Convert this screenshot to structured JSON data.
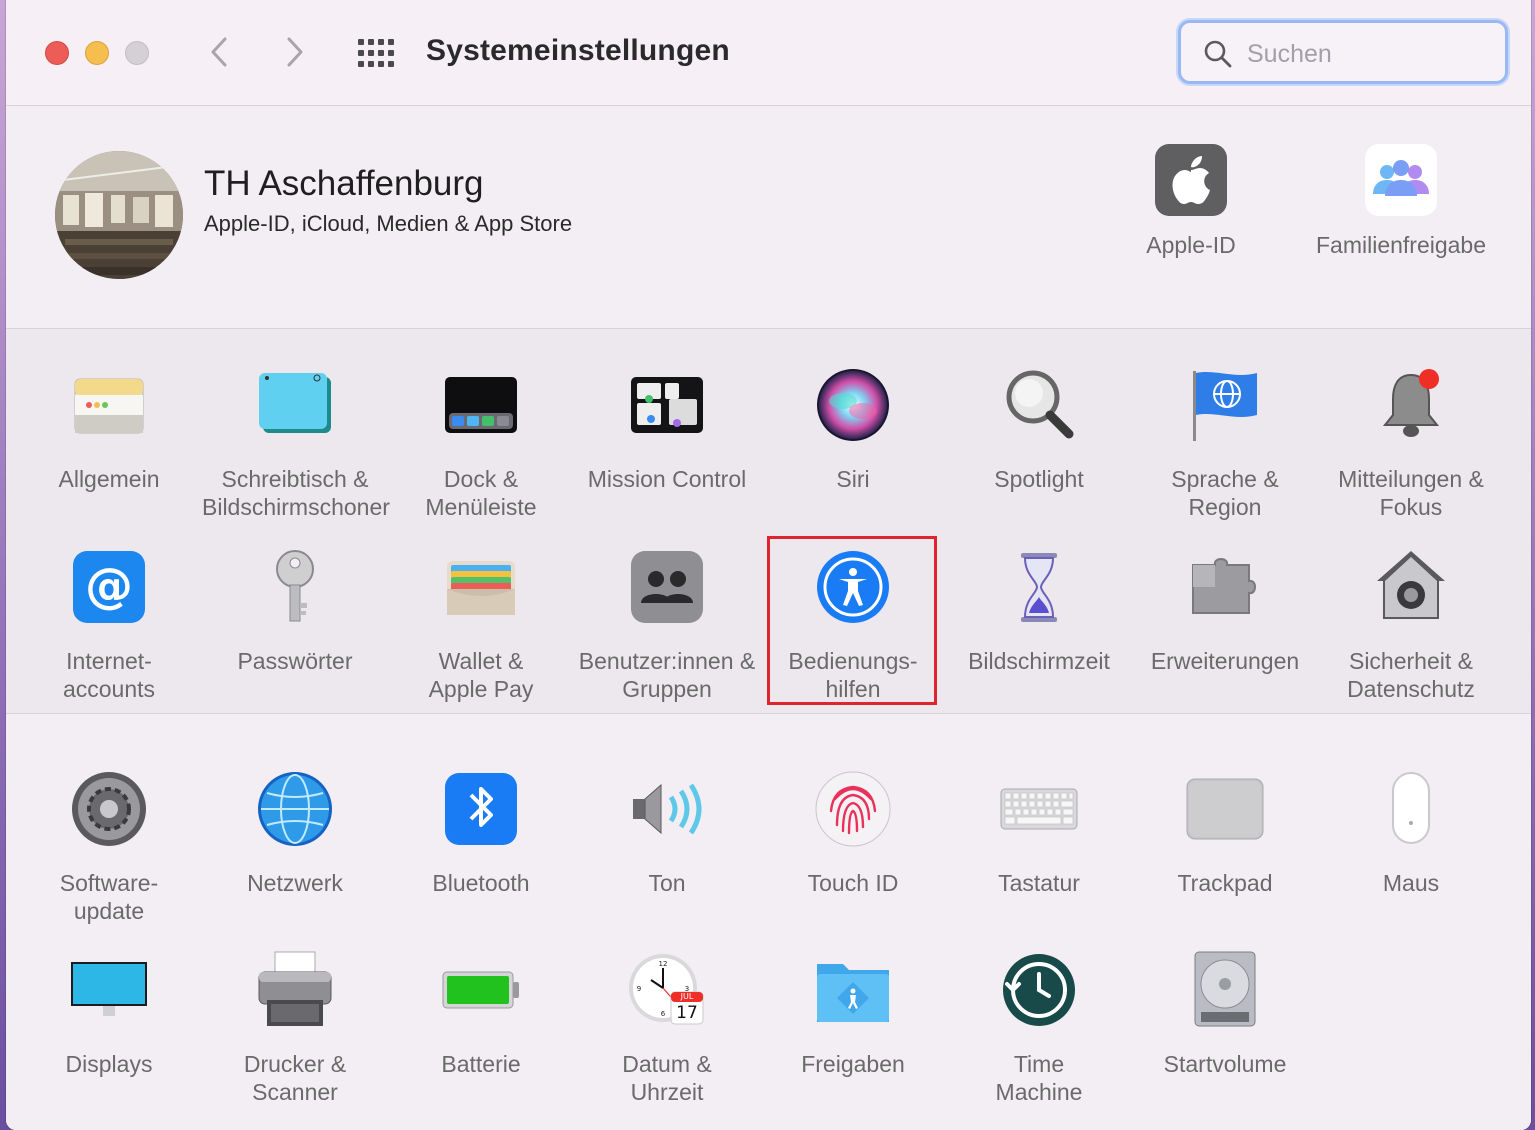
{
  "window": {
    "title": "Systemeinstellungen",
    "search_placeholder": "Suchen"
  },
  "account": {
    "name": "TH Aschaffenburg",
    "subtitle": "Apple-ID, iCloud, Medien & App Store",
    "items": [
      {
        "label": "Apple-ID",
        "icon": "apple-icon"
      },
      {
        "label": "Familienfreigabe",
        "icon": "family-sharing-icon"
      }
    ]
  },
  "prefs_row1": [
    {
      "label": "Allgemein",
      "icon": "general-icon"
    },
    {
      "label": "Schreibtisch & Bildschirmschoner",
      "icon": "desktop-screensaver-icon"
    },
    {
      "label": "Dock & Menüleiste",
      "icon": "dock-menubar-icon"
    },
    {
      "label": "Mission Control",
      "icon": "mission-control-icon"
    },
    {
      "label": "Siri",
      "icon": "siri-icon"
    },
    {
      "label": "Spotlight",
      "icon": "spotlight-icon"
    },
    {
      "label": "Sprache & Region",
      "icon": "language-region-icon"
    },
    {
      "label": "Mitteilungen & Fokus",
      "icon": "notifications-icon"
    }
  ],
  "prefs_row2": [
    {
      "label": "Internet-accounts",
      "icon": "internet-accounts-icon"
    },
    {
      "label": "Passwörter",
      "icon": "passwords-icon"
    },
    {
      "label": "Wallet & Apple Pay",
      "icon": "wallet-icon"
    },
    {
      "label": "Benutzer:innen & Gruppen",
      "icon": "users-groups-icon"
    },
    {
      "label": "Bedienungs-hilfen",
      "icon": "accessibility-icon",
      "highlighted": true
    },
    {
      "label": "Bildschirmzeit",
      "icon": "screen-time-icon"
    },
    {
      "label": "Erweiterungen",
      "icon": "extensions-icon"
    },
    {
      "label": "Sicherheit & Datenschutz",
      "icon": "security-privacy-icon"
    }
  ],
  "prefs_row3": [
    {
      "label": "Software-update",
      "icon": "software-update-icon"
    },
    {
      "label": "Netzwerk",
      "icon": "network-icon"
    },
    {
      "label": "Bluetooth",
      "icon": "bluetooth-icon"
    },
    {
      "label": "Ton",
      "icon": "sound-icon"
    },
    {
      "label": "Touch ID",
      "icon": "touch-id-icon"
    },
    {
      "label": "Tastatur",
      "icon": "keyboard-icon"
    },
    {
      "label": "Trackpad",
      "icon": "trackpad-icon"
    },
    {
      "label": "Maus",
      "icon": "mouse-icon"
    }
  ],
  "prefs_row4": [
    {
      "label": "Displays",
      "icon": "displays-icon"
    },
    {
      "label": "Drucker & Scanner",
      "icon": "printers-scanners-icon"
    },
    {
      "label": "Batterie",
      "icon": "battery-icon"
    },
    {
      "label": "Datum & Uhrzeit",
      "icon": "date-time-icon",
      "calendar_day": "17",
      "calendar_month": "JUL"
    },
    {
      "label": "Freigaben",
      "icon": "sharing-icon"
    },
    {
      "label": "Time Machine",
      "icon": "time-machine-icon"
    },
    {
      "label": "Startvolume",
      "icon": "startup-disk-icon"
    }
  ],
  "colors": {
    "highlight_border": "#e0232e",
    "label_gray": "#6a6a6a",
    "accent_blue": "#1a7cf5"
  }
}
